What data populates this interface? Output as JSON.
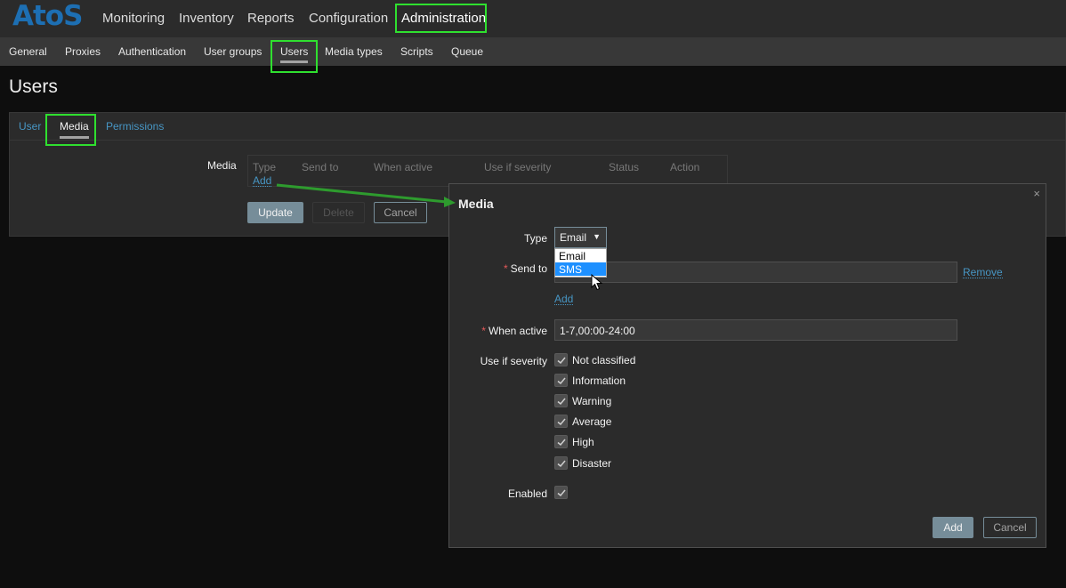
{
  "brand": {
    "logo_text": "AtoS",
    "logo_color": "#1d6fb3"
  },
  "topnav": {
    "items": [
      "Monitoring",
      "Inventory",
      "Reports",
      "Configuration",
      "Administration"
    ],
    "active": "Administration"
  },
  "subnav": {
    "items": [
      "General",
      "Proxies",
      "Authentication",
      "User groups",
      "Users",
      "Media types",
      "Scripts",
      "Queue"
    ],
    "active": "Users"
  },
  "page": {
    "title": "Users"
  },
  "tabs": {
    "items": [
      "User",
      "Media",
      "Permissions"
    ],
    "active": "Media"
  },
  "media_section": {
    "label": "Media",
    "columns": [
      "Type",
      "Send to",
      "When active",
      "Use if severity",
      "Status",
      "Action"
    ],
    "add_link": "Add"
  },
  "form_buttons": {
    "update": "Update",
    "delete": "Delete",
    "cancel": "Cancel"
  },
  "dialog": {
    "title": "Media",
    "close_glyph": "×",
    "type": {
      "label": "Type",
      "selected": "Email",
      "options": [
        "Email",
        "SMS"
      ],
      "highlighted": "SMS"
    },
    "send_to": {
      "label": "Send to",
      "value": "",
      "remove_link": "Remove",
      "add_link": "Add"
    },
    "when_active": {
      "label": "When active",
      "value": "1-7,00:00-24:00"
    },
    "severity": {
      "label": "Use if severity",
      "items": [
        {
          "label": "Not classified",
          "checked": true
        },
        {
          "label": "Information",
          "checked": true
        },
        {
          "label": "Warning",
          "checked": true
        },
        {
          "label": "Average",
          "checked": true
        },
        {
          "label": "High",
          "checked": true
        },
        {
          "label": "Disaster",
          "checked": true
        }
      ]
    },
    "enabled": {
      "label": "Enabled",
      "checked": true
    },
    "buttons": {
      "add": "Add",
      "cancel": "Cancel"
    }
  },
  "colors": {
    "highlight_box": "#2fe02f",
    "annotation_arrow": "#2e9b2e",
    "link": "#4796c4",
    "required": "#e45959"
  }
}
